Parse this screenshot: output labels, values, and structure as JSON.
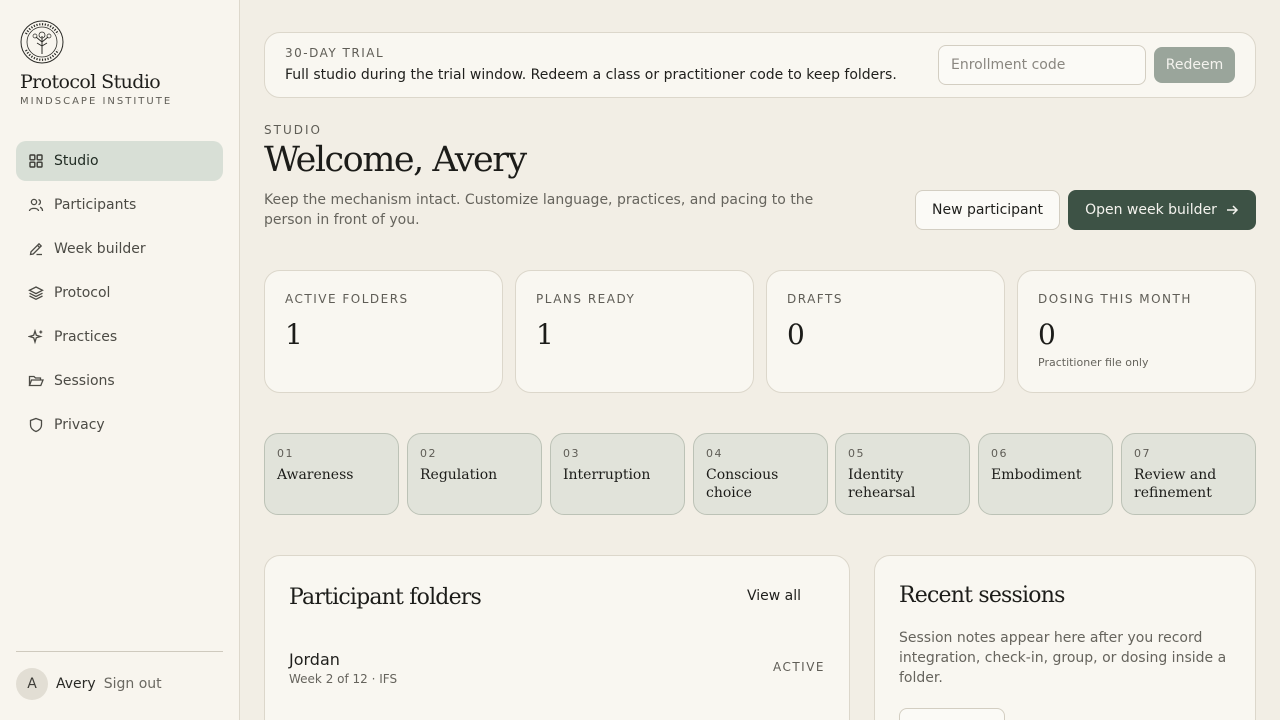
{
  "brand": {
    "title": "Protocol Studio",
    "subtitle": "MINDSCAPE INSTITUTE"
  },
  "sidebar": {
    "items": [
      {
        "label": "Studio",
        "icon": "grid-icon",
        "active": true
      },
      {
        "label": "Participants",
        "icon": "users-icon"
      },
      {
        "label": "Week builder",
        "icon": "pencil-icon"
      },
      {
        "label": "Protocol",
        "icon": "layers-icon"
      },
      {
        "label": "Practices",
        "icon": "sparkle-icon"
      },
      {
        "label": "Sessions",
        "icon": "folder-open-icon"
      },
      {
        "label": "Privacy",
        "icon": "shield-icon"
      }
    ]
  },
  "user": {
    "initial": "A",
    "name": "Avery",
    "signout": "Sign out"
  },
  "trial": {
    "label": "30-DAY TRIAL",
    "text": "Full studio during the trial window. Redeem a class or practitioner code to keep folders.",
    "input_placeholder": "Enrollment code",
    "button": "Redeem"
  },
  "header": {
    "eyebrow": "STUDIO",
    "title": "Welcome, Avery",
    "intro": "Keep the mechanism intact. Customize language, practices, and pacing to the person in front of you.",
    "new_participant": "New participant",
    "open_week_builder": "Open week builder"
  },
  "stats": [
    {
      "label": "ACTIVE FOLDERS",
      "value": "1",
      "note": ""
    },
    {
      "label": "PLANS READY",
      "value": "1",
      "note": ""
    },
    {
      "label": "DRAFTS",
      "value": "0",
      "note": ""
    },
    {
      "label": "DOSING THIS MONTH",
      "value": "0",
      "note": "Practitioner file only"
    }
  ],
  "steps": [
    {
      "num": "01",
      "name": "Awareness"
    },
    {
      "num": "02",
      "name": "Regulation"
    },
    {
      "num": "03",
      "name": "Interruption"
    },
    {
      "num": "04",
      "name": "Conscious choice"
    },
    {
      "num": "05",
      "name": "Identity rehearsal"
    },
    {
      "num": "06",
      "name": "Embodiment"
    },
    {
      "num": "07",
      "name": "Review and refinement"
    }
  ],
  "folders": {
    "title": "Participant folders",
    "view_all": "View all",
    "rows": [
      {
        "name": "Jordan",
        "meta": "Week 2 of 12 · IFS",
        "status": "ACTIVE"
      }
    ]
  },
  "sessions": {
    "title": "Recent sessions",
    "text": "Session notes appear here after you record integration, check-in, group, or dosing inside a folder."
  },
  "colors": {
    "accent": "#3d5245",
    "active_nav": "#d8dfd6",
    "background": "#f2eee5"
  }
}
